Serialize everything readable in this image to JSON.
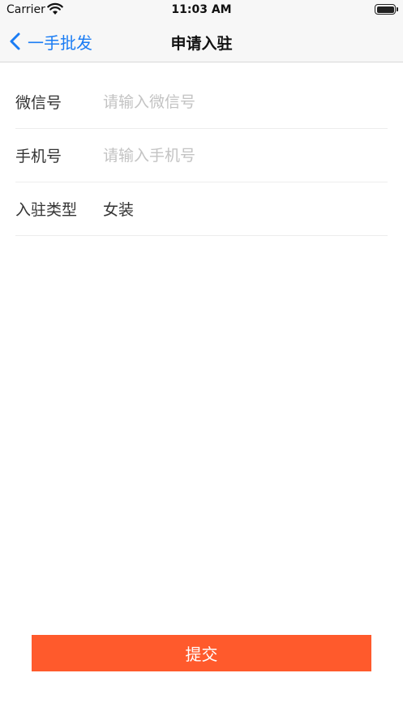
{
  "status_bar": {
    "carrier": "Carrier",
    "time": "11:03 AM",
    "wifi_icon": "wifi-icon",
    "battery_icon": "battery-icon"
  },
  "nav": {
    "back_label": "一手批发",
    "back_icon": "chevron-left-icon",
    "title": "申请入驻",
    "accent_color": "#1a7cf4"
  },
  "form": {
    "wechat": {
      "label": "微信号",
      "placeholder": "请输入微信号",
      "value": ""
    },
    "phone": {
      "label": "手机号",
      "placeholder": "请输入手机号",
      "value": ""
    },
    "type": {
      "label": "入驻类型",
      "value": "女装"
    }
  },
  "submit": {
    "label": "提交",
    "color": "#ff5a2c"
  }
}
